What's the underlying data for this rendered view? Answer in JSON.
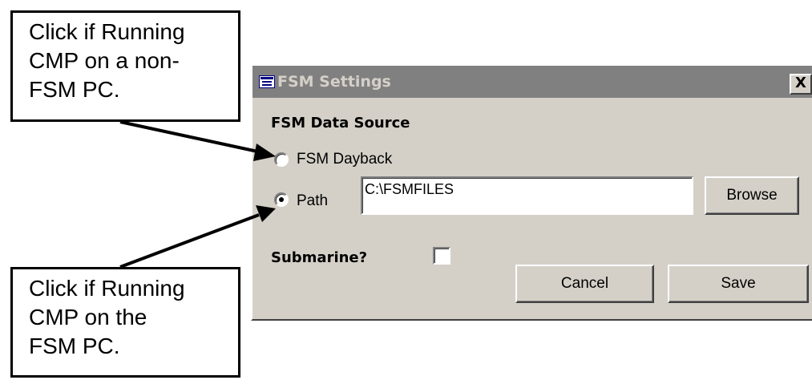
{
  "window": {
    "title": "FSM Settings",
    "close_label": "X",
    "icon": "window-system-icon"
  },
  "source": {
    "heading": "FSM Data Source",
    "option_dayback": {
      "label": "FSM Dayback",
      "checked": false
    },
    "option_path": {
      "label": "Path",
      "checked": true
    },
    "path_value": "C:\\FSMFILES",
    "browse_label": "Browse"
  },
  "submarine": {
    "label": "Submarine?",
    "checked": false
  },
  "buttons": {
    "cancel_label": "Cancel",
    "save_label": "Save"
  },
  "callouts": {
    "top": [
      "Click if Running",
      "CMP on a non-",
      "FSM PC."
    ],
    "bottom": [
      "Click if Running",
      "CMP on the",
      "FSM PC."
    ]
  }
}
